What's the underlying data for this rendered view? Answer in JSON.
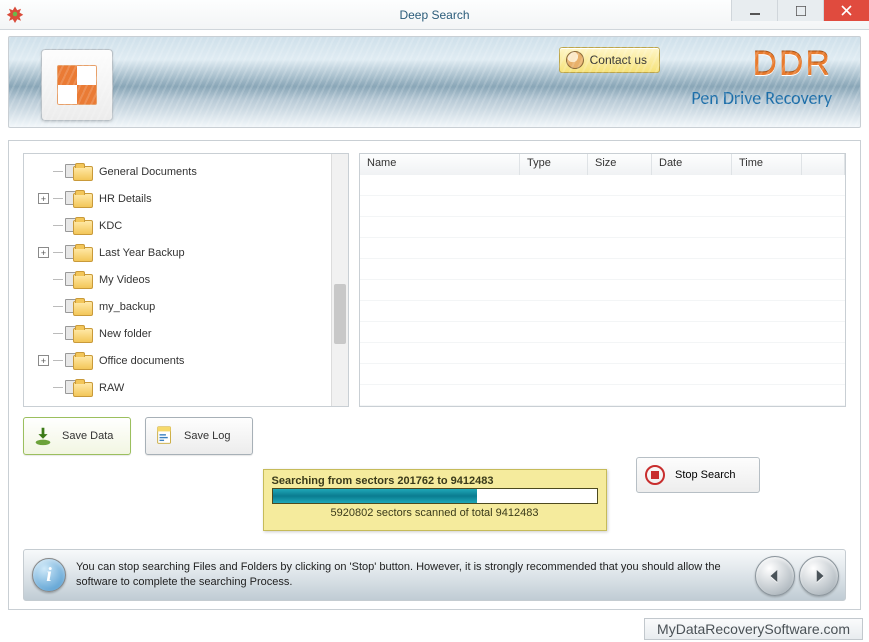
{
  "window": {
    "title": "Deep Search"
  },
  "banner": {
    "contact_label": "Contact us",
    "brand": "DDR",
    "subbrand": "Pen Drive Recovery"
  },
  "tree": {
    "items": [
      {
        "label": "General Documents",
        "expandable": false
      },
      {
        "label": "HR Details",
        "expandable": true
      },
      {
        "label": "KDC",
        "expandable": false
      },
      {
        "label": "Last Year Backup",
        "expandable": true
      },
      {
        "label": "My Videos",
        "expandable": false
      },
      {
        "label": "my_backup",
        "expandable": false
      },
      {
        "label": "New folder",
        "expandable": false
      },
      {
        "label": "Office documents",
        "expandable": true
      },
      {
        "label": "RAW",
        "expandable": false
      }
    ]
  },
  "filelist": {
    "columns": [
      "Name",
      "Type",
      "Size",
      "Date",
      "Time"
    ]
  },
  "actions": {
    "save_data": "Save Data",
    "save_log": "Save Log"
  },
  "progress": {
    "headline": "Searching from sectors  201762 to 9412483",
    "status": "5920802 sectors scanned of total 9412483",
    "percent": 63
  },
  "stop_label": "Stop Search",
  "info_text": "You can stop searching Files and Folders by clicking on 'Stop' button. However, it is strongly recommended that you should allow the software to complete the searching Process.",
  "site": "MyDataRecoverySoftware.com"
}
